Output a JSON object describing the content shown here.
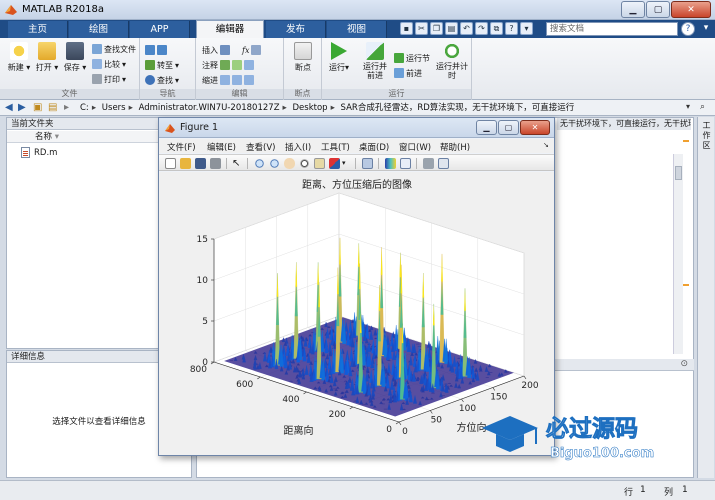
{
  "window": {
    "title": "MATLAB R2018a"
  },
  "tabs": [
    {
      "label": "主页",
      "active": false
    },
    {
      "label": "绘图",
      "active": false
    },
    {
      "label": "APP",
      "active": false
    },
    {
      "label": "编辑器",
      "active": true
    },
    {
      "label": "发布",
      "active": false
    },
    {
      "label": "视图",
      "active": false
    }
  ],
  "search": {
    "placeholder": "搜索文档"
  },
  "ribbon": {
    "file_section": {
      "label": "文件",
      "new": "新建",
      "open": "打开",
      "save": "保存",
      "find_files": "查找文件",
      "compare": "比较",
      "print": "打印"
    },
    "navigate_section": {
      "label": "导航",
      "goto": "转至",
      "find": "查找"
    },
    "edit_section": {
      "label": "编辑",
      "insert": "插入",
      "comment": "注释",
      "indent": "缩进",
      "fx": "fx"
    },
    "breakpoints_section": {
      "label": "断点",
      "breakpoints": "断点"
    },
    "run_section": {
      "label": "运行",
      "run": "运行",
      "run_advance": "运行并前进",
      "run_section_btn": "运行节",
      "advance": "前进",
      "run_time": "运行并计时"
    }
  },
  "address": {
    "segments": [
      "C:",
      "Users",
      "Administrator.WIN7U-20180127Z",
      "Desktop",
      "SAR合成孔径雷达，RD算法实现，无干扰环境下，可直接运行"
    ]
  },
  "current_folder": {
    "title": "当前文件夹",
    "column_name": "名称",
    "files": [
      "RD.m"
    ]
  },
  "details": {
    "title": "详细信息",
    "message": "选择文件以查看详细信息"
  },
  "editor": {
    "tab_label": "无干扰环境下，可直接运行，无干扰环境下，可..."
  },
  "workspace": {
    "label": "工作区"
  },
  "status": {
    "row_label": "行",
    "row_value": "1",
    "col_label": "列",
    "col_value": "1"
  },
  "figure": {
    "title": "Figure 1",
    "menu": [
      "文件(F)",
      "编辑(E)",
      "查看(V)",
      "插入(I)",
      "工具(T)",
      "桌面(D)",
      "窗口(W)",
      "帮助(H)"
    ]
  },
  "watermark": {
    "text": "必过源码",
    "url": "Biguo100.com"
  },
  "chart_data": {
    "type": "surface3d",
    "title": "距离、方位压缩后的图像",
    "xlabel": "方位向",
    "ylabel": "距离向",
    "zlabel": "",
    "x_ticks": [
      0,
      50,
      100,
      150,
      200
    ],
    "y_ticks": [
      0,
      200,
      400,
      600,
      800
    ],
    "z_ticks": [
      0,
      5,
      10,
      15
    ],
    "xlim": [
      0,
      200
    ],
    "ylim": [
      0,
      800
    ],
    "zlim": [
      0,
      15
    ],
    "grid": true,
    "colormap": "parula",
    "peaks": [
      {
        "x": 35,
        "y": 620,
        "z": 11.5
      },
      {
        "x": 65,
        "y": 620,
        "z": 12.0
      },
      {
        "x": 100,
        "y": 620,
        "z": 11.0
      },
      {
        "x": 135,
        "y": 620,
        "z": 13.0
      },
      {
        "x": 165,
        "y": 620,
        "z": 11.5
      },
      {
        "x": 35,
        "y": 440,
        "z": 12.0
      },
      {
        "x": 65,
        "y": 440,
        "z": 13.0
      },
      {
        "x": 100,
        "y": 440,
        "z": 12.5
      },
      {
        "x": 135,
        "y": 440,
        "z": 13.5
      },
      {
        "x": 165,
        "y": 440,
        "z": 12.0
      },
      {
        "x": 35,
        "y": 260,
        "z": 10.0
      },
      {
        "x": 65,
        "y": 260,
        "z": 12.5
      },
      {
        "x": 100,
        "y": 260,
        "z": 14.0
      },
      {
        "x": 135,
        "y": 260,
        "z": 12.0
      },
      {
        "x": 165,
        "y": 260,
        "z": 13.5
      },
      {
        "x": 50,
        "y": 120,
        "z": 9.5
      },
      {
        "x": 100,
        "y": 120,
        "z": 10.5
      },
      {
        "x": 150,
        "y": 120,
        "z": 11.0
      }
    ],
    "floor_level": 0.8
  }
}
